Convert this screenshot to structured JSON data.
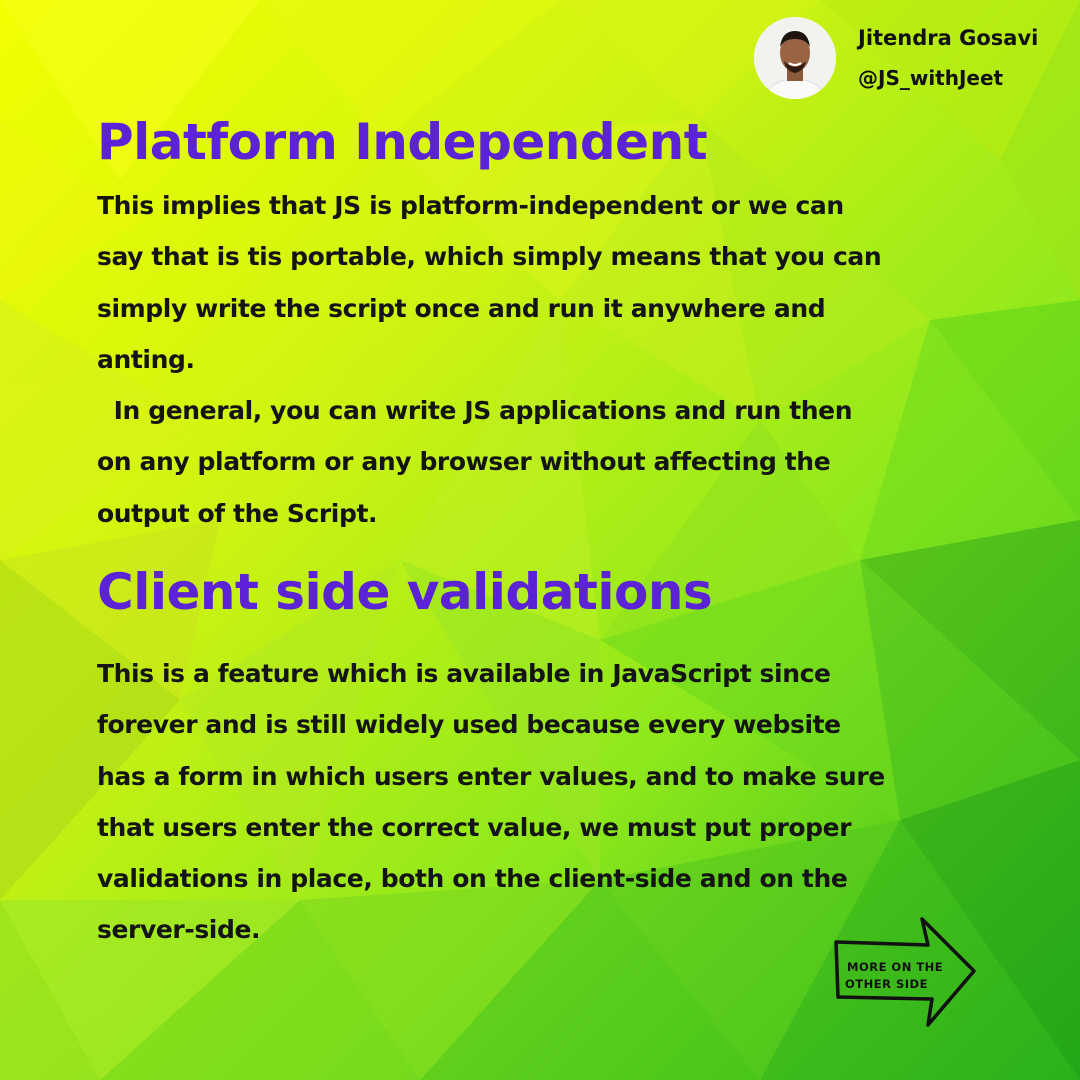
{
  "theme": {
    "heading_color": "#5b22d6",
    "text_color": "#141414",
    "background_palette": [
      "#e8ff0a",
      "#c4f21a",
      "#8ee81f",
      "#4fd21c",
      "#1fa81a"
    ]
  },
  "author": {
    "name": "Jitendra Gosavi",
    "handle": "@JS_withJeet",
    "avatar_icon": "profile-photo"
  },
  "sections": [
    {
      "heading": "Platform Independent",
      "body": "This implies that JS is platform-independent or we can\nsay that is tis portable, which simply means that you can\nsimply write the script once and run it anywhere and\nanting.\n  In general, you can write JS applications and run then\non any platform or any browser without affecting the\noutput of the Script."
    },
    {
      "heading": "Client side validations",
      "body": "This is a feature which is available in JavaScript since\nforever and is still widely used because every website\nhas a form in which users enter values, and to make sure\nthat users enter the correct value, we must put proper\nvalidations in place, both on the client-side and on the\nserver-side."
    }
  ],
  "next_arrow": {
    "line1": "MORE ON THE",
    "line2": "OTHER SIDE",
    "icon": "right-arrow-icon"
  }
}
